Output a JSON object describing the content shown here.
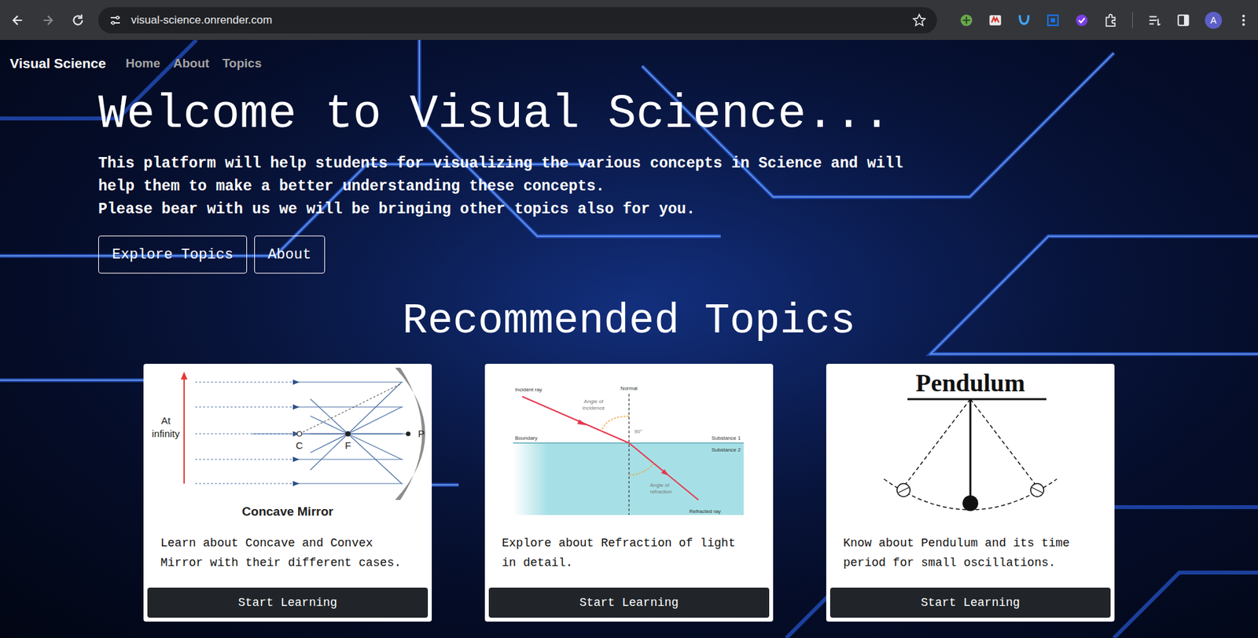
{
  "browser": {
    "url": "visual-science.onrender.com",
    "profile": "A"
  },
  "nav": {
    "brand": "Visual Science",
    "links": [
      {
        "label": "Home"
      },
      {
        "label": "About"
      },
      {
        "label": "Topics"
      }
    ]
  },
  "hero": {
    "title": "Welcome to Visual Science...",
    "lines": [
      "This platform will help students for visualizing the various concepts in Science and will",
      "help them to make a better understanding these concepts.",
      "Please bear with us we will be bringing other topics also for you."
    ],
    "buttons": [
      "Explore Topics",
      "About"
    ]
  },
  "section_title": "Recommended Topics",
  "cards": [
    {
      "kind": "mirror",
      "figure": {
        "title": "Concave Mirror",
        "at": "At",
        "infinity": "infinity",
        "c": "C",
        "f": "F",
        "p": "P"
      },
      "text": "Learn about Concave and Convex Mirror with their different cases.",
      "button": "Start Learning"
    },
    {
      "kind": "refraction",
      "figure": {
        "incident": "Incident ray",
        "normal": "Normal",
        "angle_i1": "Angle of",
        "angle_i2": "incidence",
        "right": "90°",
        "boundary": "Boundary",
        "sub1": "Substance 1",
        "sub2": "Substance 2",
        "angle_r1": "Angle of",
        "angle_r2": "refraction",
        "refracted": "Refracted ray"
      },
      "text": "Explore about Refraction of light in detail.",
      "button": "Start Learning"
    },
    {
      "kind": "pendulum",
      "figure": {
        "title": "Pendulum"
      },
      "text": "Know about Pendulum and its time period for small oscillations.",
      "button": "Start Learning"
    }
  ]
}
